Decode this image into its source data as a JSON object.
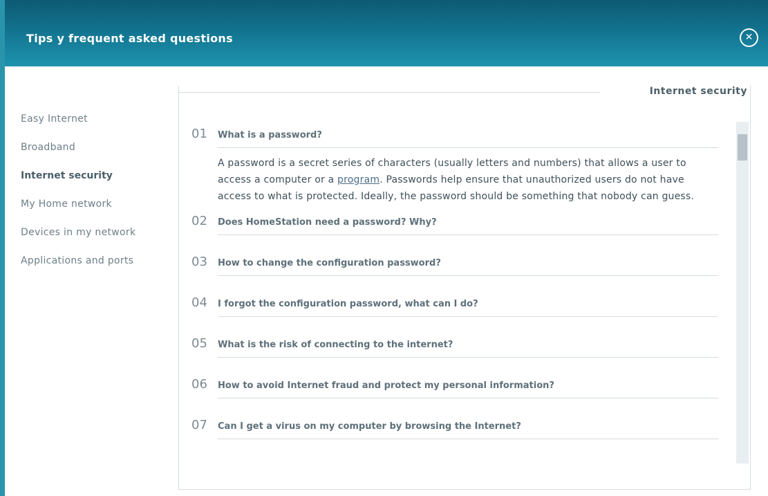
{
  "window": {
    "title": "Tips y frequent asked questions",
    "close_label": "✕",
    "colors": {
      "titlebar_top": "#0d5a73",
      "titlebar_bottom": "#1e93ae",
      "accent": "#2a94ad"
    }
  },
  "sidebar": {
    "items": [
      {
        "label": "Easy Internet",
        "active": false
      },
      {
        "label": "Broadband",
        "active": false
      },
      {
        "label": "Internet security",
        "active": true
      },
      {
        "label": "My Home network",
        "active": false
      },
      {
        "label": "Devices in my network",
        "active": false
      },
      {
        "label": "Applications and ports",
        "active": false
      }
    ]
  },
  "panel": {
    "title": "Internet security"
  },
  "faq": {
    "items": [
      {
        "number": "01",
        "question": "What is a password?",
        "answer_before": "A password is a secret series of characters (usually letters and numbers) that allows a user to access a computer or a ",
        "answer_link": "program",
        "answer_after": ". Passwords help ensure that unauthorized users do not have access to what is protected. Ideally, the password should be something that nobody can guess."
      },
      {
        "number": "02",
        "question": "Does HomeStation need a password? Why?"
      },
      {
        "number": "03",
        "question": "How to change the configuration password?"
      },
      {
        "number": "04",
        "question": "I forgot the configuration password, what can I do?"
      },
      {
        "number": "05",
        "question": "What is the risk of connecting to the internet?"
      },
      {
        "number": "06",
        "question": "How to avoid Internet fraud and protect my personal information?"
      },
      {
        "number": "07",
        "question": "Can I get a virus on my computer by browsing the Internet?"
      }
    ]
  },
  "scrollbar": {
    "position": 0.0
  }
}
